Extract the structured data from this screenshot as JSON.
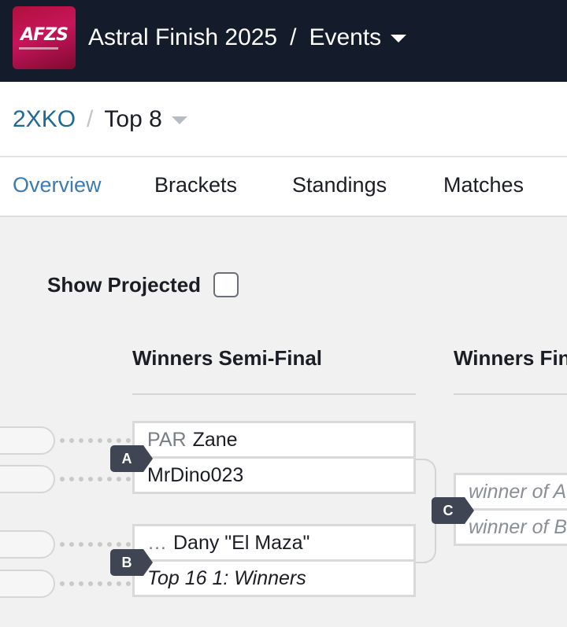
{
  "header": {
    "logo_text": "AFZS",
    "event_name": "Astral Finish 2025",
    "separator": "/",
    "section": "Events"
  },
  "breadcrumb": {
    "game": "2XKO",
    "separator": "/",
    "phase": "Top 8"
  },
  "tabs": [
    {
      "label": "Overview",
      "active": true
    },
    {
      "label": "Brackets",
      "active": false
    },
    {
      "label": "Standings",
      "active": false
    },
    {
      "label": "Matches",
      "active": false
    }
  ],
  "show_projected": {
    "label": "Show Projected",
    "checked": false
  },
  "rounds": [
    {
      "title": "Winners Semi-Final"
    },
    {
      "title": "Winners Final"
    }
  ],
  "matches": [
    {
      "id": "A",
      "slots": [
        {
          "prefix": "PAR",
          "name": "Zane",
          "style": "normal"
        },
        {
          "prefix": "",
          "name": "MrDino023",
          "style": "normal"
        }
      ]
    },
    {
      "id": "B",
      "slots": [
        {
          "prefix": "…",
          "name": "Dany \"El Maza\"",
          "style": "normal"
        },
        {
          "prefix": "",
          "name": "Top 16 1: Winners",
          "style": "pending"
        }
      ]
    },
    {
      "id": "C",
      "slots": [
        {
          "prefix": "",
          "name": "winner of A",
          "style": "projection"
        },
        {
          "prefix": "",
          "name": "winner of B",
          "style": "projection"
        }
      ]
    }
  ],
  "colors": {
    "header_bg": "#141c2b",
    "logo_bg": "#c8155a",
    "active_tab": "#3a7bb1",
    "link": "#1f6a93",
    "badge_bg": "#3f4553"
  }
}
